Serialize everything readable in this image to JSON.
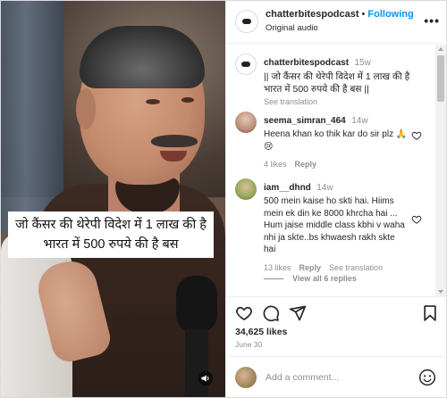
{
  "media": {
    "caption_overlay": "जो कैंसर की थेरेपी विदेश में 1 लाख की है भारत में 500 रुपये की है बस"
  },
  "header": {
    "username": "chatterbitespodcast",
    "separator": "•",
    "follow_label": "Following",
    "audio_label": "Original audio",
    "more_label": "•••"
  },
  "post_caption": {
    "username": "chatterbitespodcast",
    "time": "15w",
    "text": "|| जो कैंसर की थेरेपी विदेश में 1 लाख की है भारत में 500 रुपये की है बस ||",
    "translation_label": "See translation"
  },
  "comments": [
    {
      "username": "seema_simran_464",
      "time": "14w",
      "text": "Heena khan ko thik kar do sir plz 🙏😢",
      "likes": "4 likes",
      "reply_label": "Reply"
    },
    {
      "username": "iam__dhnd",
      "time": "14w",
      "text": "500 mein kaise ho skti hai. Hiims mein ek din ke 8000 khrcha hai ... Hum jaise middle class kbhi v waha nhi ja skte..bs khwaesh rakh skte hai",
      "likes": "13 likes",
      "reply_label": "Reply",
      "translation_label": "See translation"
    }
  ],
  "view_all_label": "View all 6 replies",
  "likes_count": "34,625 likes",
  "post_date": "June 30",
  "add_comment_placeholder": "Add a comment...",
  "colors": {
    "accent": "#0095f6",
    "muted": "#8e8e8e",
    "text": "#262626"
  }
}
